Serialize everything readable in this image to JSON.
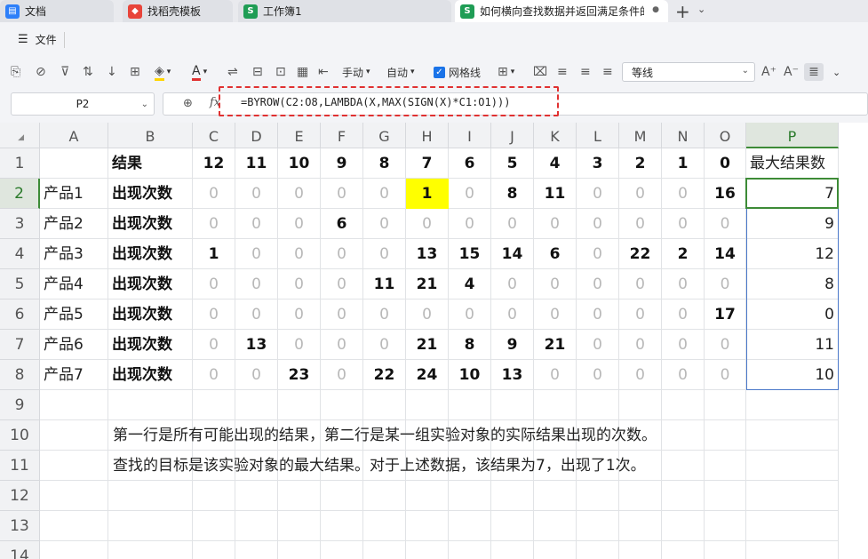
{
  "tabs": [
    {
      "label": "文档",
      "icon": "docs-icon",
      "color": "#2d7ff9"
    },
    {
      "label": "找稻壳模板",
      "icon": "docer-icon",
      "color": "#e8443a"
    },
    {
      "label": "工作簿1",
      "icon": "spreadsheet-icon",
      "color": "#1f9d55"
    },
    {
      "label": "如何横向查找数据并返回满足条件的",
      "icon": "spreadsheet-icon",
      "color": "#1f9d55"
    }
  ],
  "menu": {
    "file": "文件"
  },
  "toolbar": {
    "wrap_manual": "手动",
    "wrap_auto": "自动",
    "gridlines": "网格线",
    "font_name": "等线"
  },
  "name_box": "P2",
  "formula": "=BYROW(C2:O8,LAMBDA(X,MAX(SIGN(X)*C1:O1)))",
  "columns": [
    "A",
    "B",
    "C",
    "D",
    "E",
    "F",
    "G",
    "H",
    "I",
    "J",
    "K",
    "L",
    "M",
    "N",
    "O",
    "P"
  ],
  "rows": [
    "1",
    "2",
    "3",
    "4",
    "5",
    "6",
    "7",
    "8",
    "9",
    "10",
    "11",
    "12",
    "13",
    "14"
  ],
  "header_row": {
    "label": "结果",
    "values": [
      "12",
      "11",
      "10",
      "9",
      "8",
      "7",
      "6",
      "5",
      "4",
      "3",
      "2",
      "1",
      "0"
    ],
    "result_header": "最大结果数"
  },
  "data_rows": [
    {
      "product": "产品1",
      "label": "出现次数",
      "values": [
        "0",
        "0",
        "0",
        "0",
        "0",
        "1",
        "0",
        "8",
        "11",
        "0",
        "0",
        "0",
        "16"
      ],
      "result": "7"
    },
    {
      "product": "产品2",
      "label": "出现次数",
      "values": [
        "0",
        "0",
        "0",
        "6",
        "0",
        "0",
        "0",
        "0",
        "0",
        "0",
        "0",
        "0",
        "0"
      ],
      "result": "9"
    },
    {
      "product": "产品3",
      "label": "出现次数",
      "values": [
        "1",
        "0",
        "0",
        "0",
        "0",
        "13",
        "15",
        "14",
        "6",
        "0",
        "22",
        "2",
        "14"
      ],
      "result": "12"
    },
    {
      "product": "产品4",
      "label": "出现次数",
      "values": [
        "0",
        "0",
        "0",
        "0",
        "11",
        "21",
        "4",
        "0",
        "0",
        "0",
        "0",
        "0",
        "0"
      ],
      "result": "8"
    },
    {
      "product": "产品5",
      "label": "出现次数",
      "values": [
        "0",
        "0",
        "0",
        "0",
        "0",
        "0",
        "0",
        "0",
        "0",
        "0",
        "0",
        "0",
        "17"
      ],
      "result": "0"
    },
    {
      "product": "产品6",
      "label": "出现次数",
      "values": [
        "0",
        "13",
        "0",
        "0",
        "0",
        "21",
        "8",
        "9",
        "21",
        "0",
        "0",
        "0",
        "0"
      ],
      "result": "11"
    },
    {
      "product": "产品7",
      "label": "出现次数",
      "values": [
        "0",
        "0",
        "23",
        "0",
        "22",
        "24",
        "10",
        "13",
        "0",
        "0",
        "0",
        "0",
        "0"
      ],
      "result": "10"
    }
  ],
  "notes": [
    "第一行是所有可能出现的结果，第二行是某一组实验对象的实际结果出现的次数。",
    "查找的目标是该实验对象的最大结果。对于上述数据，该结果为7，出现了1次。"
  ],
  "colors": {
    "highlight": "#ffff00",
    "formula_outline": "#e03131",
    "selection": "#3d8b37"
  }
}
